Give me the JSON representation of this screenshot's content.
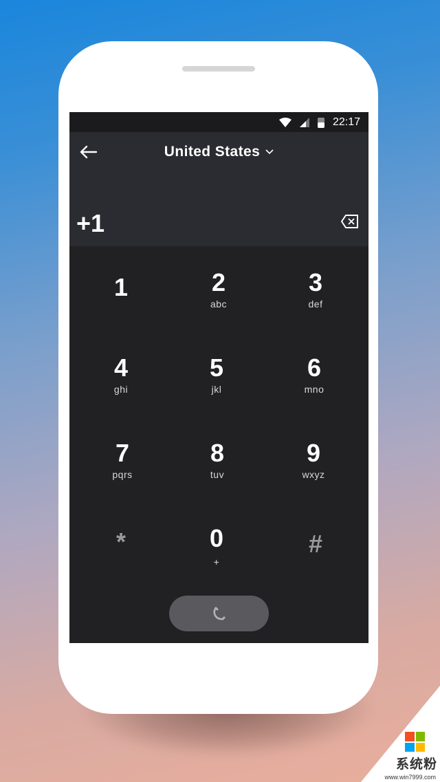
{
  "status_bar": {
    "time": "22:17",
    "icons": [
      "wifi-icon",
      "cellular-signal-icon",
      "battery-icon"
    ]
  },
  "header": {
    "back_icon": "arrow-left-icon",
    "country": "United States",
    "country_dropdown_icon": "chevron-down-icon",
    "dialed_number": "+1",
    "backspace_icon": "backspace-icon"
  },
  "keypad": {
    "keys": [
      {
        "digit": "1",
        "letters": ""
      },
      {
        "digit": "2",
        "letters": "abc"
      },
      {
        "digit": "3",
        "letters": "def"
      },
      {
        "digit": "4",
        "letters": "ghi"
      },
      {
        "digit": "5",
        "letters": "jkl"
      },
      {
        "digit": "6",
        "letters": "mno"
      },
      {
        "digit": "7",
        "letters": "pqrs"
      },
      {
        "digit": "8",
        "letters": "tuv"
      },
      {
        "digit": "9",
        "letters": "wxyz"
      },
      {
        "digit": "*",
        "letters": ""
      },
      {
        "digit": "0",
        "letters": "+"
      },
      {
        "digit": "#",
        "letters": ""
      }
    ]
  },
  "call_button": {
    "icon": "phone-icon"
  },
  "watermark": {
    "text": "系统粉",
    "url": "www.win7999.com",
    "logo_colors": [
      "#f25022",
      "#7fba00",
      "#00a4ef",
      "#ffb900"
    ]
  }
}
